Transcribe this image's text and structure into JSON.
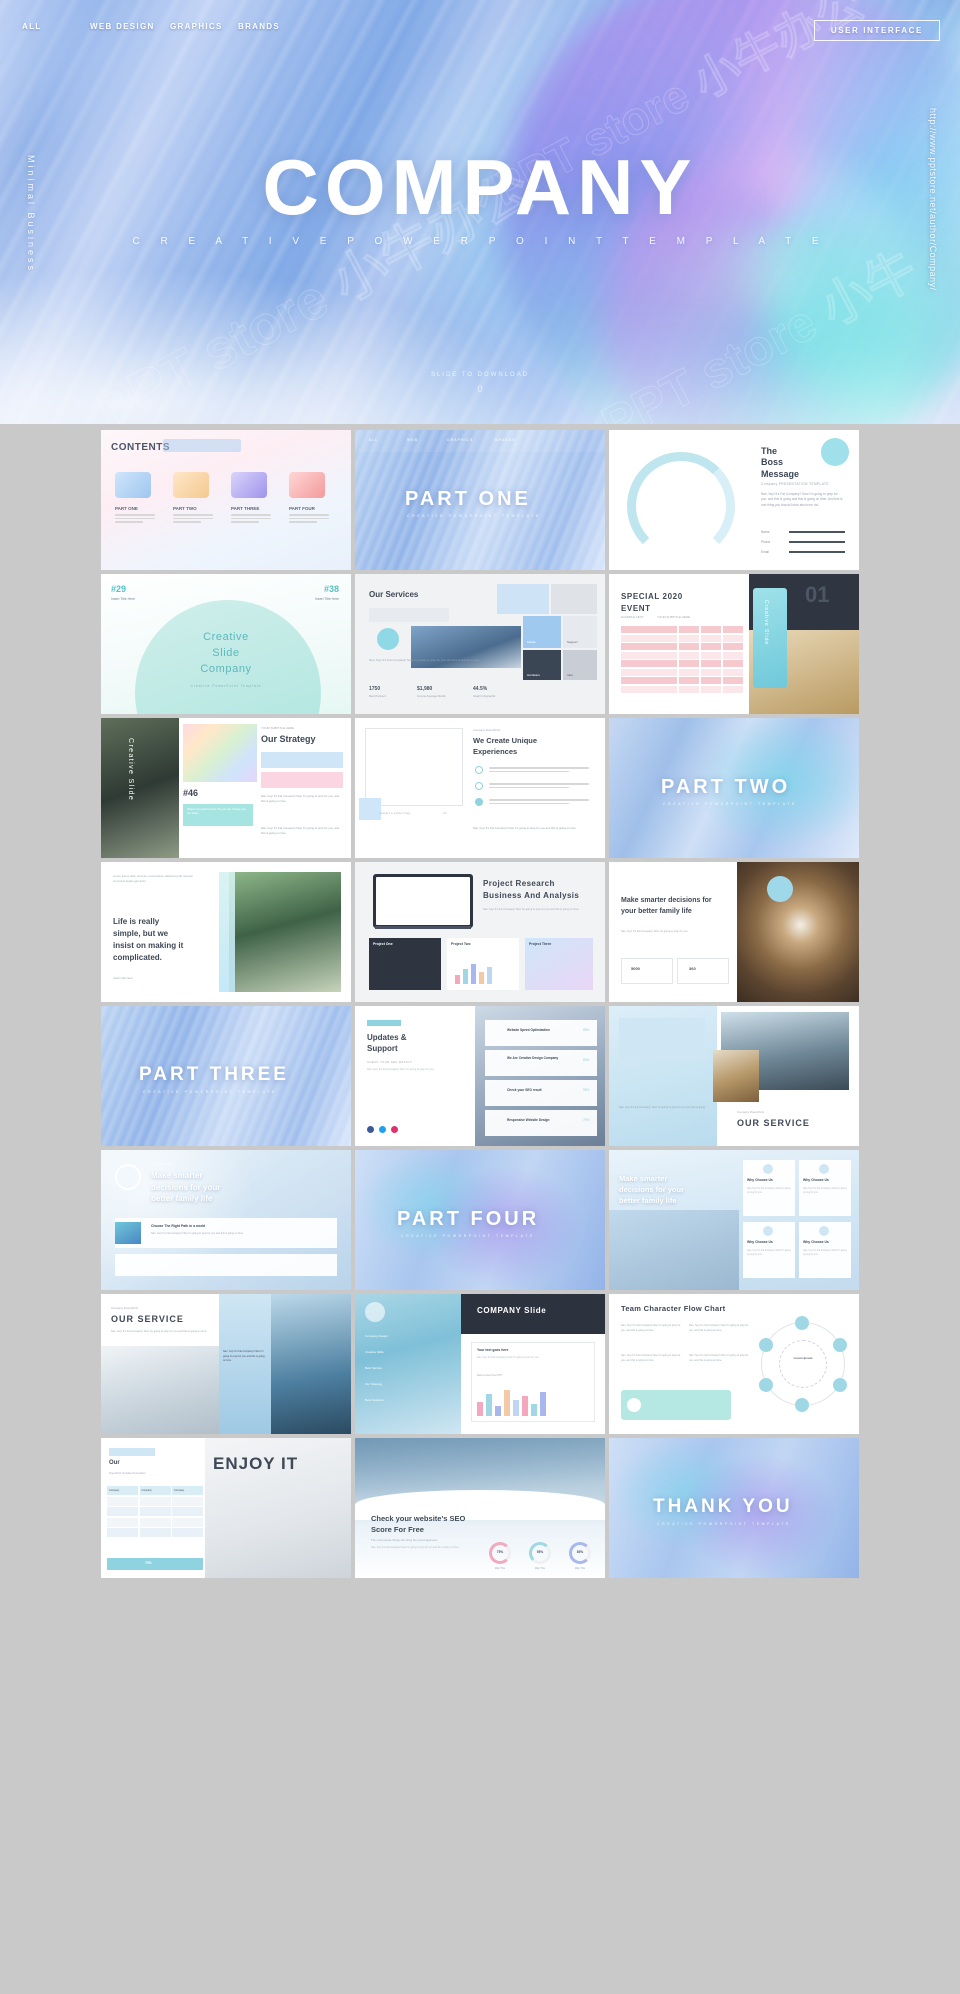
{
  "hero": {
    "nav": [
      "ALL",
      "WEB DESIGN",
      "GRAPHICS",
      "BRANDS"
    ],
    "badge": "USER INTERFACE",
    "title": "COMPANY",
    "subtitle": "C R E A T I V E      P O W E R P O I N T      T E M P L A T E",
    "side_left": "Minimal Business",
    "side_right": "http://www.pptstore.net/author/Company/",
    "footer_note": "SLIDE TO DOWNLOAD",
    "footer_dot": "0",
    "watermark": "PPT store 小牛办公"
  },
  "slides": [
    {
      "id": "contents",
      "title": "CONTENTS",
      "cards": [
        {
          "label": "PART ONE",
          "icon": "browser-icon"
        },
        {
          "label": "PART TWO",
          "icon": "book-icon"
        },
        {
          "label": "PART THREE",
          "icon": "star-icon"
        },
        {
          "label": "PART FOUR",
          "icon": "capsule-icon"
        }
      ],
      "body": "Nan, hey! It's Fat Company! Now I'm here for you, and this is going to be"
    },
    {
      "id": "part-one",
      "title": "PART ONE",
      "subtitle": "CREATIVE POWERPOINT TEMPLATE",
      "nav": [
        "ALL",
        "WEB",
        "GRAPHICS",
        "BRANDS"
      ]
    },
    {
      "id": "boss-message",
      "title": "The\nBoss\nMessage",
      "kicker": "Company PRESENTATION TEMPLATE",
      "body": "Nan, hey! It's Fat Company? Now I'm going to prep for you, and this is going and this is going on time. And this is one thing you should know about me too.",
      "fields": [
        "Name",
        "Phone",
        "Email"
      ]
    },
    {
      "id": "creative-slide-numbers",
      "num_left": "#29",
      "num_right": "#38",
      "label_left": "Insert Title Here",
      "label_right": "Insert Title Here",
      "title": "Creative\nSlide\nCompany",
      "sub": "Creative PowerPoint Template"
    },
    {
      "id": "our-services",
      "title": "Our Services",
      "tiles": [
        "Mobile",
        "Support",
        "Hardware",
        "Idea"
      ],
      "stats": [
        {
          "value": "1750",
          "label": "Best Partners"
        },
        {
          "value": "$1,980",
          "label": "Income Average Month"
        },
        {
          "value": "44.5%",
          "label": "Graph Infographic"
        }
      ],
      "body": "Nan, hey! It's Fat Company! Now I'm going to prep for you and this is going on time."
    },
    {
      "id": "special-event",
      "title": "SPECIAL  2020",
      "title2": "EVENT",
      "kicker": "EXAMPLE TEXT",
      "sub": "YOUR SUBTITLE HERE",
      "badge": "Creative Slide",
      "number": "01",
      "table_rows": 8
    },
    {
      "id": "our-strategy",
      "side": "Creative Slide",
      "kicker": "YOUR SUBTITLE HERE",
      "title": "Our Strategy",
      "num": "#46",
      "note": "Please use typed number this you can change your text freely.",
      "body": "Nan, hey! It's Fat Company! Now I'm going to prep for you, and this is going on time."
    },
    {
      "id": "unique-experiences",
      "kicker": "Company PowerPoint",
      "title": "We Create Unique\nExperiences",
      "caption": "Change it to another image",
      "pager": "4/4",
      "body": "Nan, hey! It's Fat Company! Now I'm going to prep for you and this is going on time."
    },
    {
      "id": "part-two",
      "title": "PART TWO",
      "subtitle": "CREATIVE POWERPOINT TEMPLATE"
    },
    {
      "id": "life-simple",
      "quote": "Life is really\nsimple, but we\ninsist on making it\ncomplicated.",
      "footer": "Insert title here",
      "body": "Lorem ipsum dolor sit amet, consectetuer adipiscing elit. Aenean commodo ligula eget dolor."
    },
    {
      "id": "project-research",
      "title": "Project Research\nBusiness And Analysis",
      "cards": [
        "Project One",
        "Project Two",
        "Project Three"
      ],
      "body": "Nan, hey! It's Fat Company! Now I'm going to prep for you and this is going on time."
    },
    {
      "id": "smarter-decisions-a",
      "title": "Make smarter decisions for\nyour better family life",
      "stats": [
        "5000",
        "360"
      ],
      "body": "Nan, hey! It's Fat Company! Now I'm going to prep for you."
    },
    {
      "id": "part-three",
      "title": "PART THREE",
      "subtitle": "CREATIVE POWERPOINT TEMPLATE"
    },
    {
      "id": "updates-support",
      "title": "Updates &\nSupport",
      "kicker": "CHECK YOUR SEO RESULT",
      "items": [
        {
          "label": "Website Speed Optimization",
          "value": "85%"
        },
        {
          "label": "We Are Creative Design Company",
          "value": "80%"
        },
        {
          "label": "Check your SEO result",
          "value": "95%"
        },
        {
          "label": "Responsive Website Design",
          "value": "75%"
        }
      ],
      "body": "Nan, hey! It's Fat Company! Now I'm going to prep for you."
    },
    {
      "id": "our-service-a",
      "title": "OUR  SERVICE",
      "kicker": "Company PowerPoint",
      "body": "Nan, hey! It's Fat Company! Now I'm going to prep for you and this is going."
    },
    {
      "id": "smarter-decisions-b",
      "kicker": "Insert Title Here",
      "title": "Make smarter\ndecisions for your\nbetter family life",
      "sub": "Choose The Right Path in a world",
      "body": "Nan, hey! It's Fat Company! Now I'm going to prep for you and this is going on time."
    },
    {
      "id": "part-four",
      "title": "PART  FOUR",
      "subtitle": "CREATIVE POWERPOINT TEMPLATE"
    },
    {
      "id": "why-choose-us",
      "title": "Make smarter\ndecisions for your\nbetter family life",
      "cards": [
        "Why Choose Us",
        "Why Choose Us",
        "Why Choose Us",
        "Why Choose Us"
      ],
      "body": "Nan, hey! It's Fat Company! Now I'm going to prep for you."
    },
    {
      "id": "our-service-b",
      "kicker": "Company PowerPoint",
      "title": "OUR  SERVICE",
      "body": "Nan, hey! It's Fat Company! Now I'm going to prep for you and this is going on time."
    },
    {
      "id": "company-slide",
      "title": "COMPANY Slide",
      "card_title": "Your text goes here",
      "menu": [
        "Company Design",
        "Creative Slide",
        "Best Service",
        "Our Strategy",
        "Best Features"
      ],
      "note": "Data comes from PPT",
      "body": "Nan, hey! It's Fat Company! Now I'm going to prep for you."
    },
    {
      "id": "team-chart",
      "title": "Team Character Flow Chart",
      "center": "Lorem Ipsum",
      "body": "Nan, hey! It's Fat Company! Now I'm going to prep for you, and this is going on time."
    },
    {
      "id": "our-enjoy",
      "title": "Our",
      "big": "ENJOY IT",
      "kicker": "PowerPoint Template Presentation",
      "progress": "75%",
      "table_cols": [
        "Company",
        "Company",
        "Company"
      ]
    },
    {
      "id": "seo-score",
      "title": "Check your website's SEO\nScore For Free",
      "sub": "The most simple things can bring the most happiness.",
      "donuts": [
        {
          "value": "75%",
          "label": "Main Title"
        },
        {
          "value": "55%",
          "label": "Main Title"
        },
        {
          "value": "85%",
          "label": "Main Title"
        }
      ],
      "body": "Nan, hey! It's Fat Company! Now I'm going to prep for you and this is going on time."
    },
    {
      "id": "thank-you",
      "title": "THANK  YOU",
      "subtitle": "CREATIVE POWERPOINT TEMPLATE"
    }
  ],
  "colors": {
    "accent_blue": "#8fb2e8",
    "accent_mint": "#8fe0da",
    "accent_pink": "#f7d0dd",
    "dark": "#2b3340",
    "page_bg": "#c9c9c9"
  }
}
